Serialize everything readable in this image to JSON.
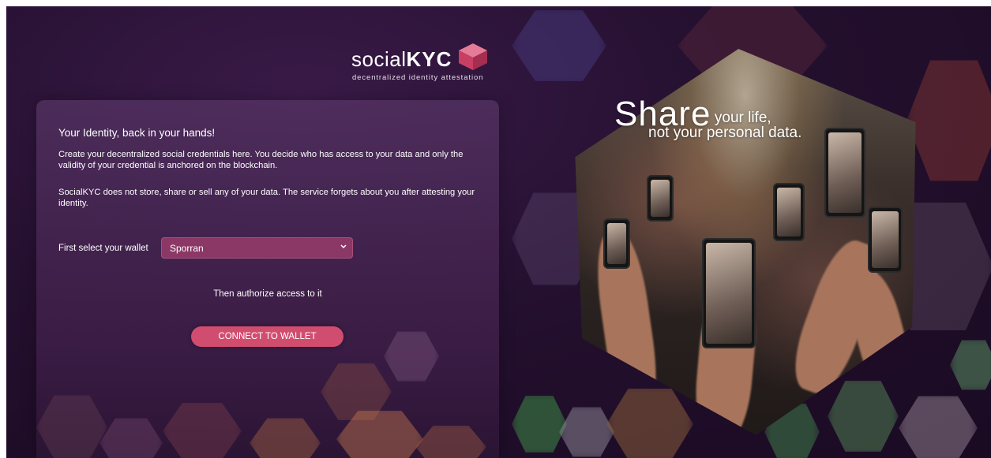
{
  "logo": {
    "word_light": "social",
    "word_bold": "KYC",
    "tagline": "decentralized identity attestation"
  },
  "card": {
    "heading": "Your Identity, back in your hands!",
    "paragraph1": "Create your decentralized social credentials here. You decide who has access to your data and only the validity of your credential is anchored on the blockchain.",
    "paragraph2": "SocialKYC does not store, share or sell any of your data. The service forgets about you after attesting your identity.",
    "wallet_label": "First select your wallet",
    "wallet_selected": "Sporran",
    "then_text": "Then authorize access to it",
    "connect_button": "CONNECT TO WALLET"
  },
  "hero": {
    "share": "Share",
    "line1": "your life,",
    "line2": "not your personal data."
  },
  "colors": {
    "accent": "#d14d6f",
    "select_bg": "#8c3866",
    "background": "#24102f"
  }
}
